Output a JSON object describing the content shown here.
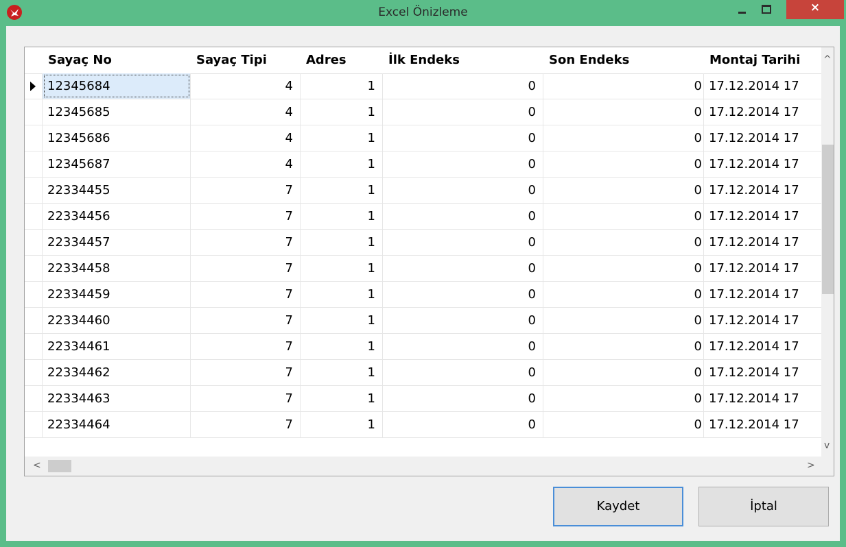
{
  "window": {
    "title": "Excel Önizleme",
    "accent_color": "#5bbd89",
    "close_color": "#c7443b",
    "app_icon": "red-bird-logo-icon"
  },
  "titlebar_buttons": {
    "minimize": "–",
    "maximize": "□",
    "close": "×"
  },
  "grid": {
    "columns": [
      "Sayaç No",
      "Sayaç Tipi",
      "Adres",
      "İlk Endeks",
      "Son Endeks",
      "Montaj Tarihi"
    ],
    "rows": [
      {
        "sayac_no": "12345684",
        "sayac_tipi": "4",
        "adres": "1",
        "ilk_endeks": "0",
        "son_endeks": "0",
        "montaj_tarihi": "17.12.2014 17"
      },
      {
        "sayac_no": "12345685",
        "sayac_tipi": "4",
        "adres": "1",
        "ilk_endeks": "0",
        "son_endeks": "0",
        "montaj_tarihi": "17.12.2014 17"
      },
      {
        "sayac_no": "12345686",
        "sayac_tipi": "4",
        "adres": "1",
        "ilk_endeks": "0",
        "son_endeks": "0",
        "montaj_tarihi": "17.12.2014 17"
      },
      {
        "sayac_no": "12345687",
        "sayac_tipi": "4",
        "adres": "1",
        "ilk_endeks": "0",
        "son_endeks": "0",
        "montaj_tarihi": "17.12.2014 17"
      },
      {
        "sayac_no": "22334455",
        "sayac_tipi": "7",
        "adres": "1",
        "ilk_endeks": "0",
        "son_endeks": "0",
        "montaj_tarihi": "17.12.2014 17"
      },
      {
        "sayac_no": "22334456",
        "sayac_tipi": "7",
        "adres": "1",
        "ilk_endeks": "0",
        "son_endeks": "0",
        "montaj_tarihi": "17.12.2014 17"
      },
      {
        "sayac_no": "22334457",
        "sayac_tipi": "7",
        "adres": "1",
        "ilk_endeks": "0",
        "son_endeks": "0",
        "montaj_tarihi": "17.12.2014 17"
      },
      {
        "sayac_no": "22334458",
        "sayac_tipi": "7",
        "adres": "1",
        "ilk_endeks": "0",
        "son_endeks": "0",
        "montaj_tarihi": "17.12.2014 17"
      },
      {
        "sayac_no": "22334459",
        "sayac_tipi": "7",
        "adres": "1",
        "ilk_endeks": "0",
        "son_endeks": "0",
        "montaj_tarihi": "17.12.2014 17"
      },
      {
        "sayac_no": "22334460",
        "sayac_tipi": "7",
        "adres": "1",
        "ilk_endeks": "0",
        "son_endeks": "0",
        "montaj_tarihi": "17.12.2014 17"
      },
      {
        "sayac_no": "22334461",
        "sayac_tipi": "7",
        "adres": "1",
        "ilk_endeks": "0",
        "son_endeks": "0",
        "montaj_tarihi": "17.12.2014 17"
      },
      {
        "sayac_no": "22334462",
        "sayac_tipi": "7",
        "adres": "1",
        "ilk_endeks": "0",
        "son_endeks": "0",
        "montaj_tarihi": "17.12.2014 17"
      },
      {
        "sayac_no": "22334463",
        "sayac_tipi": "7",
        "adres": "1",
        "ilk_endeks": "0",
        "son_endeks": "0",
        "montaj_tarihi": "17.12.2014 17"
      },
      {
        "sayac_no": "22334464",
        "sayac_tipi": "7",
        "adres": "1",
        "ilk_endeks": "0",
        "son_endeks": "0",
        "montaj_tarihi": "17.12.2014 17"
      }
    ],
    "selected_row": 0,
    "scroll_arrows": {
      "up": "^",
      "down": "v",
      "left": "<",
      "right": ">"
    }
  },
  "buttons": {
    "save": "Kaydet",
    "cancel": "İptal"
  }
}
